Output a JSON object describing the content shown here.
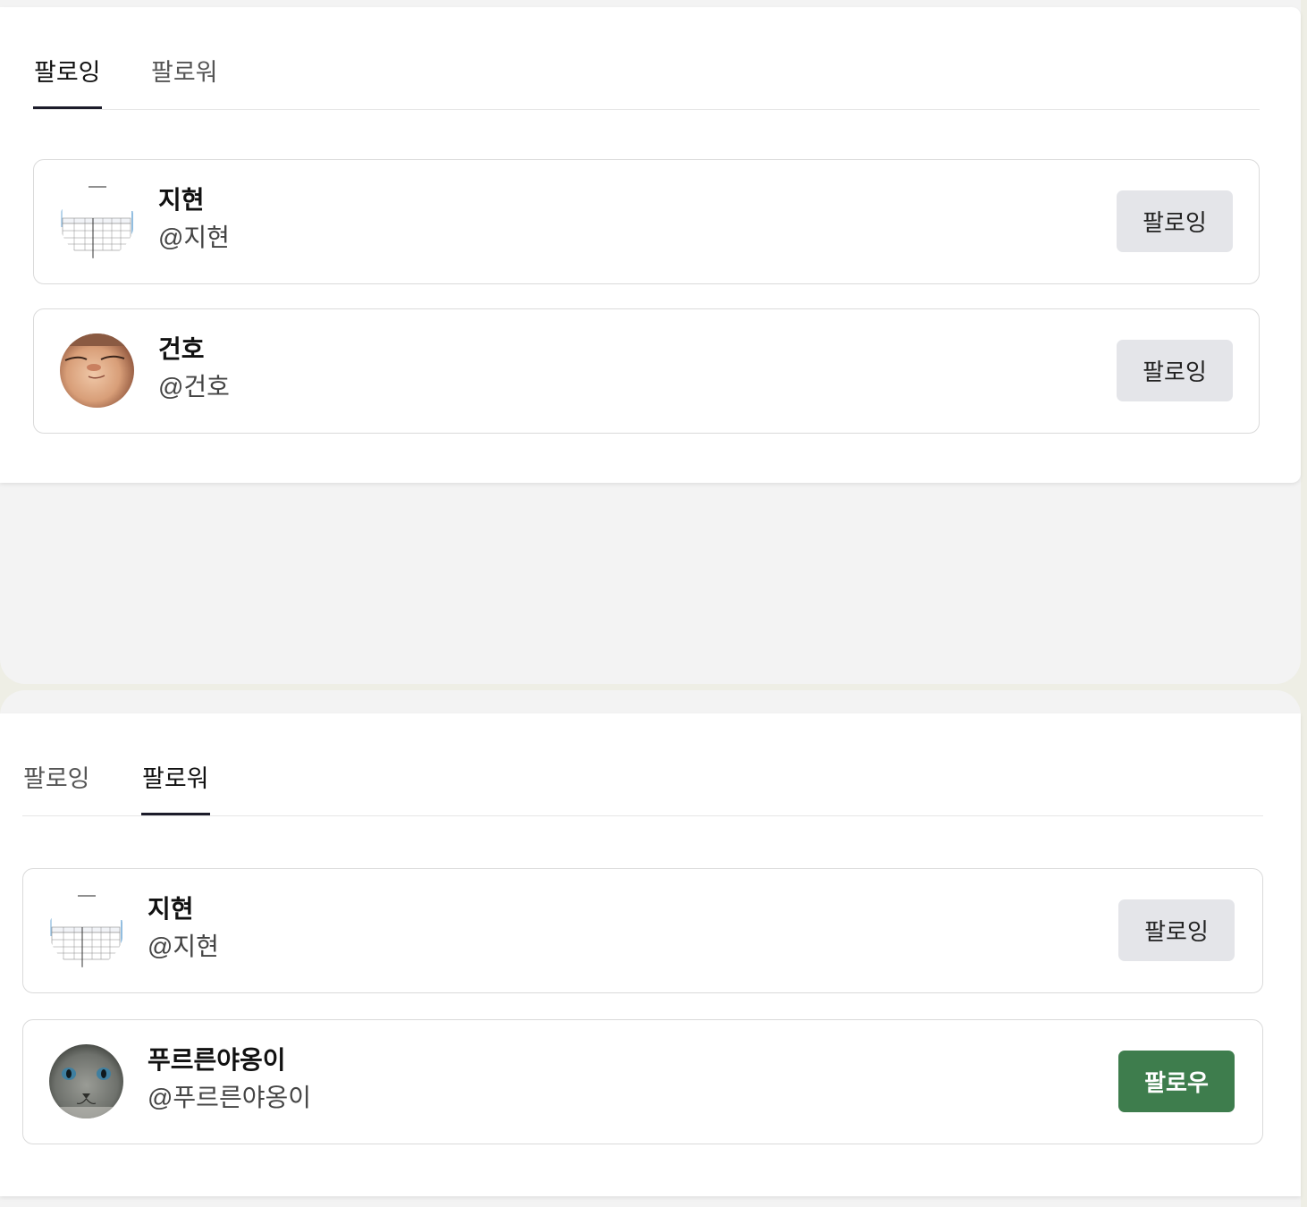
{
  "panels": [
    {
      "tabs": [
        {
          "label": "팔로잉",
          "active": true
        },
        {
          "label": "팔로워",
          "active": false
        }
      ],
      "users": [
        {
          "name": "지현",
          "handle": "@지현",
          "button": "팔로잉",
          "button_state": "following",
          "avatar": "sheet-avatar"
        },
        {
          "name": "건호",
          "handle": "@건호",
          "button": "팔로잉",
          "button_state": "following",
          "avatar": "face-avatar"
        }
      ]
    },
    {
      "tabs": [
        {
          "label": "팔로잉",
          "active": false
        },
        {
          "label": "팔로워",
          "active": true
        }
      ],
      "users": [
        {
          "name": "지현",
          "handle": "@지현",
          "button": "팔로잉",
          "button_state": "following",
          "avatar": "sheet-avatar"
        },
        {
          "name": "푸르른야옹이",
          "handle": "@푸르른야옹이",
          "button": "팔로우",
          "button_state": "follow",
          "avatar": "cat-avatar"
        }
      ]
    }
  ],
  "colors": {
    "follow_button": "#3e7d4d",
    "following_button": "#e4e5e9",
    "active_tab_underline": "#1c1c2a"
  }
}
